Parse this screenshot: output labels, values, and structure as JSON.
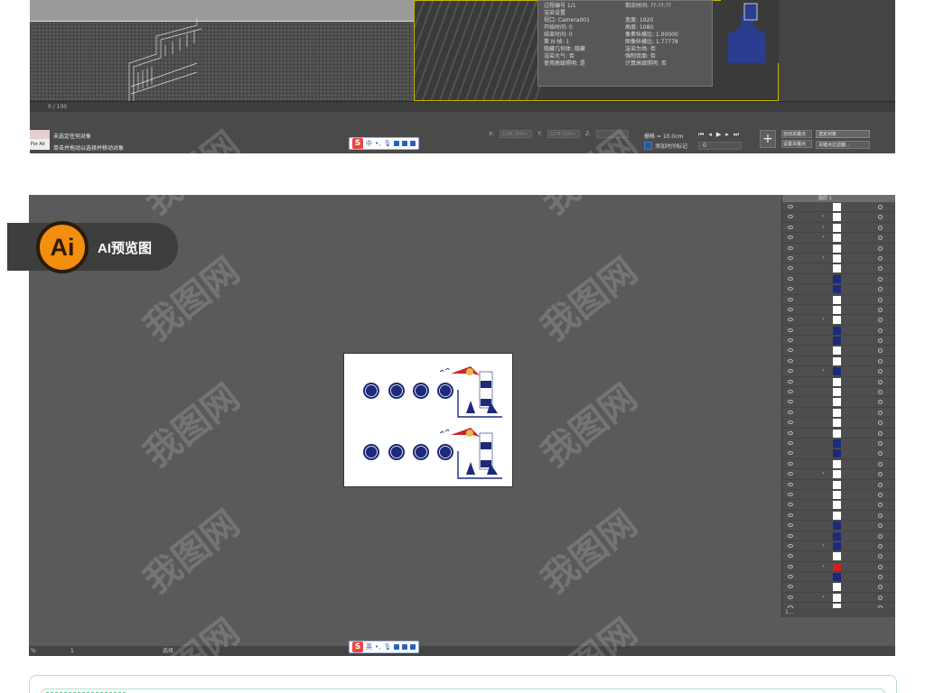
{
  "max_window": {
    "time_slider": "0 / 100",
    "render_dialog": {
      "process_frame": "过程编号 1/1",
      "remaining": "剩余时间: ??:??:??",
      "section": "渲染设置",
      "rows": [
        [
          "视口: Camera001",
          "宽度: 1920"
        ],
        [
          "开始时间: 0",
          "高度: 1080"
        ],
        [
          "结束时间: 0",
          "像素纵横比: 1.00000"
        ],
        [
          "第 N 帧: 1",
          "图像纵横比: 1.77778"
        ],
        [
          "隐藏几何体: 隐藏",
          "渲染为场: 否"
        ],
        [
          "渲染大气: 否",
          "强制双面: 否"
        ],
        [
          "使用高级照明: 是",
          "计算高级照明: 否"
        ]
      ]
    },
    "status": {
      "line1": "未选定任何对象",
      "line2": "单击并拖动以选择并移动对象",
      "for_all": "For All",
      "x_label": "X:",
      "x_value": "2296.306m",
      "y_label": "Y:",
      "y_value": "2278.306m",
      "z_label": "Z:",
      "grid": "栅格 = 10.0cm",
      "add_time_tag": "添加时间标记",
      "frame_value": "0",
      "auto_key": "自动关键点",
      "set_key": "设置关键点",
      "selection_set": "选定对象",
      "key_filters": "关键点过滤器..."
    }
  },
  "ime_bar_top": {
    "logo": "S",
    "mode": "中"
  },
  "ime_bar_bottom": {
    "logo": "S",
    "mode": "英"
  },
  "ai_badge": {
    "logo": "Ai",
    "label": "AI预览图"
  },
  "ai_window": {
    "layer_name": "图层 1",
    "bottom_status": "选择",
    "zoom": "%",
    "page": "1",
    "layers_footer": "1..."
  },
  "watermark": "我图网",
  "colors": {
    "navy": "#1d2a7a",
    "red": "#c8262b",
    "ai_orange": "#f48e0e",
    "green_frame": "#b8dccb"
  }
}
